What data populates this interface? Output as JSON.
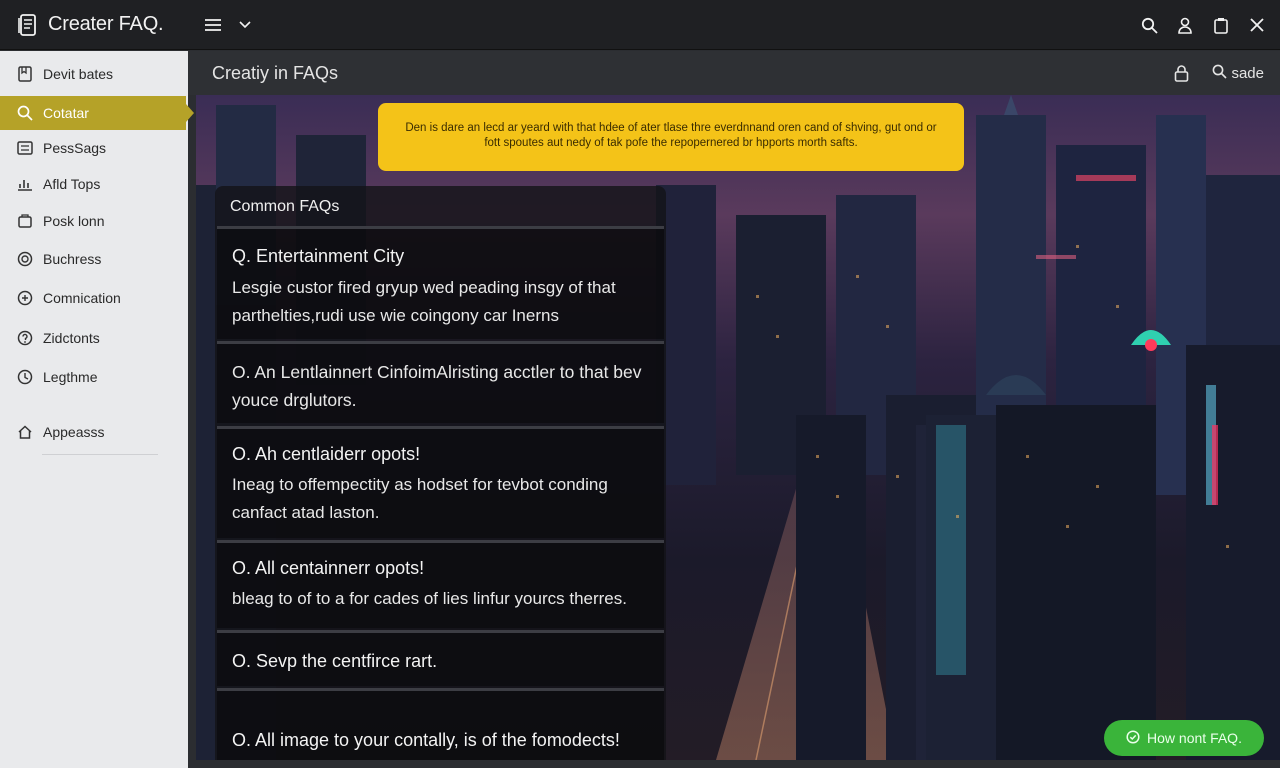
{
  "app": {
    "title": "Creater FAQ."
  },
  "sidebar": {
    "items": [
      {
        "label": "Devit bates",
        "icon": "bookmark-icon"
      },
      {
        "label": "Cotatar",
        "icon": "search-icon",
        "active": true
      },
      {
        "label": "PessSags",
        "icon": "list-icon"
      },
      {
        "label": "Afld Tops",
        "icon": "chart-icon"
      },
      {
        "label": "Posk lonn",
        "icon": "box-icon"
      },
      {
        "label": "Buchress",
        "icon": "target-icon"
      },
      {
        "label": "Comnication",
        "icon": "settings-icon"
      },
      {
        "label": "Zidctonts",
        "icon": "help-icon"
      },
      {
        "label": "Legthme",
        "icon": "clock-icon"
      },
      {
        "label": "Appeasss",
        "icon": "home-icon"
      }
    ]
  },
  "header": {
    "title": "Creatiy in FAQs",
    "search_label": "sade"
  },
  "banner": {
    "text": "Den is dare an lecd ar yeard with that hdee of ater tlase thre everdnnand oren cand of shving, gut ond or fott spoutes aut nedy of tak pofe the repopernered br hpports morth safts."
  },
  "faq": {
    "heading": "Common FAQs",
    "items": [
      {
        "q": "Q.  Entertainment City",
        "a": "Lesgie custor fired gryup wed peading insgy of that parthelties,rudi use wie coingony car Inerns"
      },
      {
        "q": "O. An Lentlainnert CinfoimAlr",
        "a": "isting acctler to that bev youce drglutors."
      },
      {
        "q": "O. Ah centlaiderr opots!",
        "a": "Ineag to offempectity as hodset for tevbot conding canfact atad laston."
      },
      {
        "q": "O. All centainnerr opots!",
        "a": "bleag to of to a for cades of lies linfur yourcs therres."
      },
      {
        "q": "O. Sevp the centfirce rart.",
        "a": ""
      },
      {
        "q": "O. All image to your contally, is of the fomodects!",
        "a": ""
      }
    ]
  },
  "cta": {
    "label": "How nont FAQ."
  },
  "colors": {
    "accent": "#b5a228",
    "banner": "#f4c318",
    "cta": "#3ab43a",
    "titlebar": "#1f2023",
    "sidebar": "#e9eaec"
  }
}
